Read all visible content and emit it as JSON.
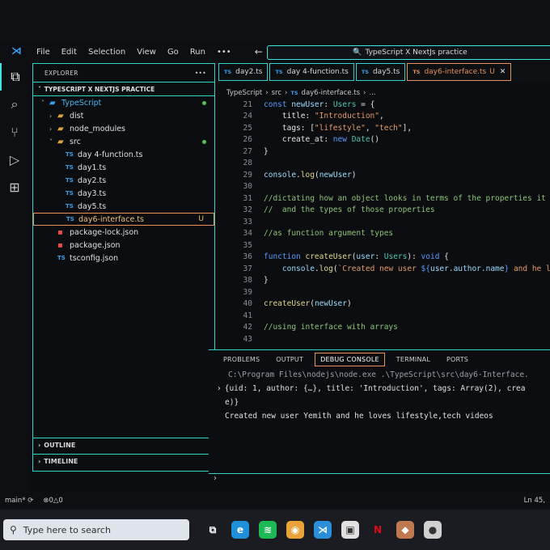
{
  "window": {
    "menu": [
      "File",
      "Edit",
      "Selection",
      "View",
      "Go",
      "Run",
      "•••"
    ],
    "nav_arrows": "← →",
    "search_text": "TypeScript X NextJs practice"
  },
  "activity_icons": [
    "files-icon",
    "search-icon",
    "source-control-icon",
    "run-debug-icon",
    "extensions-icon"
  ],
  "sidebar": {
    "header": "EXPLORER",
    "header_more": "•••",
    "project": "TYPESCRIPT X NEXTJS PRACTICE",
    "tree": [
      {
        "label": "TypeScript",
        "indent": 1,
        "chev": "˅",
        "kind": "folder-blue",
        "dot": true,
        "ts_color": true
      },
      {
        "label": "dist",
        "indent": 2,
        "chev": "›",
        "kind": "folder"
      },
      {
        "label": "node_modules",
        "indent": 2,
        "chev": "›",
        "kind": "folder"
      },
      {
        "label": "src",
        "indent": 2,
        "chev": "˅",
        "kind": "folder",
        "dot": true
      },
      {
        "label": "day 4-function.ts",
        "indent": 3,
        "kind": "ts"
      },
      {
        "label": "day1.ts",
        "indent": 3,
        "kind": "ts"
      },
      {
        "label": "day2.ts",
        "indent": 3,
        "kind": "ts"
      },
      {
        "label": "day3.ts",
        "indent": 3,
        "kind": "ts"
      },
      {
        "label": "day5.ts",
        "indent": 3,
        "kind": "ts"
      },
      {
        "label": "day6-interface.ts",
        "indent": 3,
        "kind": "ts",
        "selected": true,
        "badge": "U"
      },
      {
        "label": "package-lock.json",
        "indent": 2,
        "kind": "json"
      },
      {
        "label": "package.json",
        "indent": 2,
        "kind": "json"
      },
      {
        "label": "tsconfig.json",
        "indent": 2,
        "kind": "ts"
      }
    ],
    "outline": "OUTLINE",
    "timeline": "TIMELINE"
  },
  "tabs": [
    {
      "label": "day2.ts",
      "active": false
    },
    {
      "label": "day 4-function.ts",
      "active": false
    },
    {
      "label": "day5.ts",
      "active": false
    },
    {
      "label": "day6-interface.ts",
      "active": true,
      "modified": "U",
      "close": "✕"
    }
  ],
  "breadcrumb": [
    "TypeScript",
    "src",
    "day6-interface.ts",
    "..."
  ],
  "editor": {
    "lines": [
      {
        "n": "21",
        "tokens": [
          [
            "kw",
            "const "
          ],
          [
            "var",
            "newUser"
          ],
          [
            "code",
            ": "
          ],
          [
            "ty",
            "Users"
          ],
          [
            "code",
            " = {"
          ]
        ]
      },
      {
        "n": "24",
        "tokens": [
          [
            "code",
            "    title: "
          ],
          [
            "str",
            "\"Introduction\""
          ],
          [
            "code",
            ","
          ]
        ]
      },
      {
        "n": "25",
        "tokens": [
          [
            "code",
            "    tags: ["
          ],
          [
            "str",
            "\"lifestyle\""
          ],
          [
            "code",
            ", "
          ],
          [
            "str",
            "\"tech\""
          ],
          [
            "code",
            "],"
          ]
        ]
      },
      {
        "n": "26",
        "tokens": [
          [
            "code",
            "    create_at: "
          ],
          [
            "kw",
            "new "
          ],
          [
            "ty",
            "Date"
          ],
          [
            "code",
            "()"
          ]
        ]
      },
      {
        "n": "27",
        "tokens": [
          [
            "code",
            "}"
          ]
        ]
      },
      {
        "n": "28",
        "tokens": []
      },
      {
        "n": "29",
        "tokens": [
          [
            "var",
            "console"
          ],
          [
            "code",
            "."
          ],
          [
            "fn",
            "log"
          ],
          [
            "code",
            "("
          ],
          [
            "var",
            "newUser"
          ],
          [
            "code",
            ")"
          ]
        ]
      },
      {
        "n": "30",
        "tokens": []
      },
      {
        "n": "31",
        "tokens": [
          [
            "cmt",
            "//dictating how an object looks in terms of the properties it h"
          ]
        ]
      },
      {
        "n": "32",
        "tokens": [
          [
            "cmt",
            "//  and the types of those properties"
          ]
        ]
      },
      {
        "n": "33",
        "tokens": []
      },
      {
        "n": "34",
        "tokens": [
          [
            "cmt",
            "//as function argument types"
          ]
        ]
      },
      {
        "n": "35",
        "tokens": []
      },
      {
        "n": "36",
        "tokens": [
          [
            "kw",
            "function "
          ],
          [
            "fn",
            "createUser"
          ],
          [
            "code",
            "("
          ],
          [
            "var",
            "user"
          ],
          [
            "code",
            ": "
          ],
          [
            "ty",
            "Users"
          ],
          [
            "code",
            "): "
          ],
          [
            "kw",
            "void"
          ],
          [
            "code",
            " {"
          ]
        ]
      },
      {
        "n": "37",
        "tokens": [
          [
            "code",
            "    "
          ],
          [
            "var",
            "console"
          ],
          [
            "code",
            "."
          ],
          [
            "fn",
            "log"
          ],
          [
            "code",
            "("
          ],
          [
            "str",
            "`Created new user "
          ],
          [
            "kw",
            "${"
          ],
          [
            "var",
            "user.author.name"
          ],
          [
            "kw",
            "}"
          ],
          [
            "str",
            " and he l"
          ]
        ]
      },
      {
        "n": "38",
        "tokens": [
          [
            "code",
            "}"
          ]
        ]
      },
      {
        "n": "39",
        "tokens": []
      },
      {
        "n": "40",
        "tokens": [
          [
            "fn",
            "createUser"
          ],
          [
            "code",
            "("
          ],
          [
            "var",
            "newUser"
          ],
          [
            "code",
            ")"
          ]
        ]
      },
      {
        "n": "41",
        "tokens": []
      },
      {
        "n": "42",
        "tokens": [
          [
            "cmt",
            "//using interface with arrays"
          ]
        ]
      },
      {
        "n": "43",
        "tokens": []
      }
    ]
  },
  "panel": {
    "tabs": [
      "PROBLEMS",
      "OUTPUT",
      "DEBUG CONSOLE",
      "TERMINAL",
      "PORTS"
    ],
    "active_tab": "DEBUG CONSOLE",
    "lines": [
      {
        "text": "C:\\Program Files\\nodejs\\node.exe .\\TypeScript\\src\\day6-Interface.",
        "kind": "path"
      },
      {
        "text": "{uid: 1, author: {…}, title: 'Introduction', tags: Array(2), crea",
        "kind": "obj",
        "caret": "›"
      },
      {
        "text": "e)}",
        "kind": "obj"
      },
      {
        "text": "Created new user Yemith and he loves lifestyle,tech videos",
        "kind": "out"
      }
    ],
    "input_caret": "›"
  },
  "status": {
    "branch": "main*",
    "sync": "⟳",
    "problems": "⊗0△0",
    "extra": "🔔",
    "position": "Ln 45,"
  },
  "taskbar": {
    "search_placeholder": "Type here to search",
    "icons": [
      "task-view-icon",
      "edge-icon",
      "spotify-icon",
      "chrome-icon",
      "vscode-icon",
      "app-icon",
      "netflix-icon",
      "game-icon",
      "profile-icon"
    ]
  }
}
